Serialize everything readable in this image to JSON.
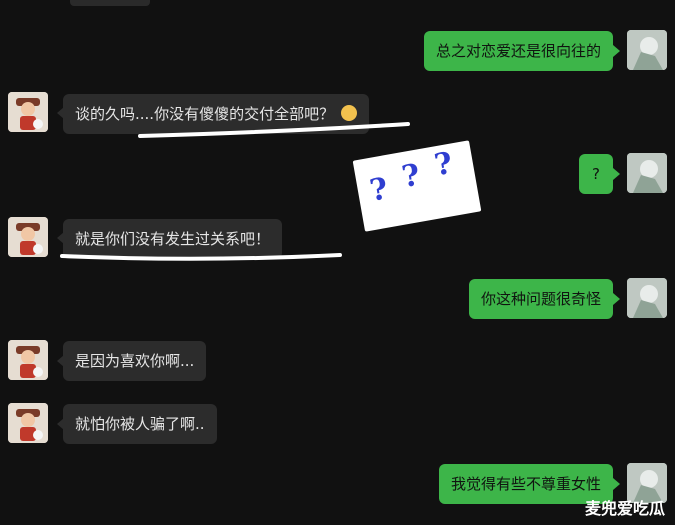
{
  "conversation": {
    "messages": [
      {
        "side": "right",
        "text": "总之对恋爱还是很向往的"
      },
      {
        "side": "left",
        "text": "谈的久吗....你没有傻傻的交付全部吧？",
        "emoji": "face-emoji"
      },
      {
        "side": "right",
        "text": "?"
      },
      {
        "side": "left",
        "text": "就是你们没有发生过关系吧！"
      },
      {
        "side": "right",
        "text": "你这种问题很奇怪"
      },
      {
        "side": "left",
        "text": "是因为喜欢你啊..."
      },
      {
        "side": "left",
        "text": "就怕你被人骗了啊.."
      },
      {
        "side": "right",
        "text": "我觉得有些不尊重女性"
      }
    ]
  },
  "annotation": {
    "question_marks": [
      "?",
      "?",
      "?"
    ],
    "underline_color": "#ffffff",
    "question_color": "#2f3ed0"
  },
  "watermark": "麦兜爱吃瓜",
  "colors": {
    "background": "#111111",
    "incoming_bubble": "#2c2c2c",
    "outgoing_bubble": "#3db549"
  }
}
